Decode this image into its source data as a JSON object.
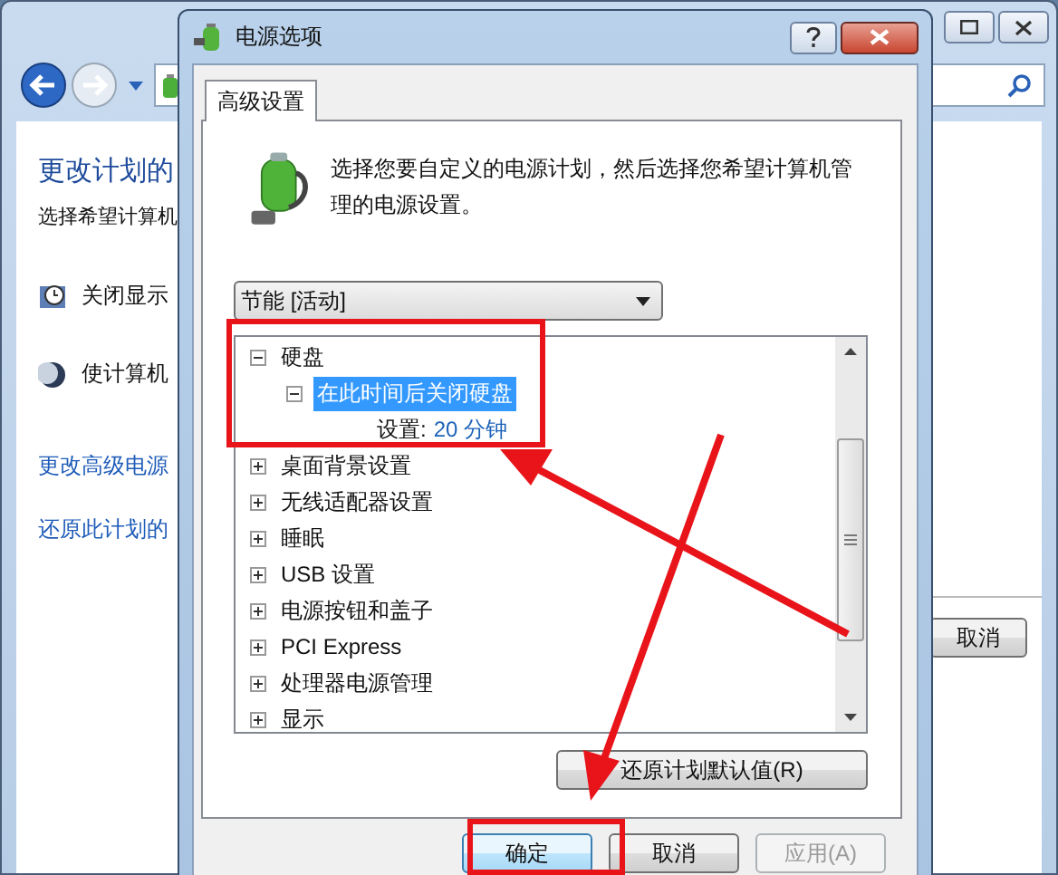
{
  "background_window": {
    "heading": "更改计划的",
    "subheading": "选择希望计算机",
    "settings": [
      {
        "kind": "clock",
        "label": "关闭显示"
      },
      {
        "kind": "moon",
        "label": "使计算机"
      }
    ],
    "links": [
      "更改高级电源",
      "还原此计划的"
    ],
    "cancel_button": "取消"
  },
  "dialog": {
    "title": "电源选项",
    "tabs": [
      {
        "label": "高级设置",
        "selected": true
      }
    ],
    "description": "选择您要自定义的电源计划，然后选择您希望计算机管理的电源设置。",
    "plan_select": {
      "value": "节能 [活动]"
    },
    "tree": [
      {
        "label": "硬盘",
        "expanded": true,
        "selected": false,
        "children": [
          {
            "label": "在此时间后关闭硬盘",
            "expanded": true,
            "selected": true,
            "setting": {
              "label": "设置:",
              "value": "20 分钟"
            }
          }
        ]
      },
      {
        "label": "桌面背景设置",
        "expanded": false,
        "selected": false
      },
      {
        "label": "无线适配器设置",
        "expanded": false,
        "selected": false
      },
      {
        "label": "睡眠",
        "expanded": false,
        "selected": false
      },
      {
        "label": "USB 设置",
        "expanded": false,
        "selected": false
      },
      {
        "label": "电源按钮和盖子",
        "expanded": false,
        "selected": false
      },
      {
        "label": "PCI Express",
        "expanded": false,
        "selected": false
      },
      {
        "label": "处理器电源管理",
        "expanded": false,
        "selected": false
      },
      {
        "label": "显示",
        "expanded": false,
        "selected": false
      }
    ],
    "restore_button": "还原计划默认值(R)",
    "buttons": [
      {
        "label": "确定",
        "disabled": false
      },
      {
        "label": "取消",
        "disabled": false
      },
      {
        "label": "应用(A)",
        "disabled": true
      }
    ]
  }
}
